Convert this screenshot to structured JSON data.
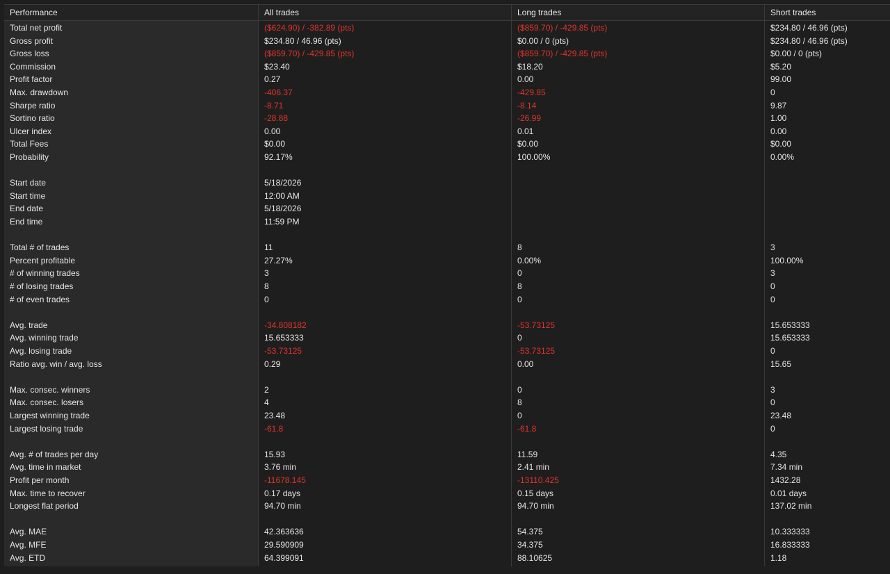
{
  "header": {
    "performance": "Performance",
    "all": "All trades",
    "long": "Long trades",
    "short": "Short trades"
  },
  "colors": {
    "negative": "#e0342a",
    "text": "#e6e6e6",
    "background": "#1e1e1e",
    "label_background": "#2a2a2a"
  },
  "rows": [
    {
      "label": "Total net profit",
      "all": "($624.90) / -382.89 (pts)",
      "long": "($859.70) / -429.85 (pts)",
      "short": "$234.80 / 46.96 (pts)",
      "neg": [
        1,
        1,
        0
      ]
    },
    {
      "label": "Gross profit",
      "all": "$234.80 / 46.96 (pts)",
      "long": "$0.00 / 0 (pts)",
      "short": "$234.80 / 46.96 (pts)",
      "neg": [
        0,
        0,
        0
      ]
    },
    {
      "label": "Gross loss",
      "all": "($859.70) / -429.85 (pts)",
      "long": "($859.70) / -429.85 (pts)",
      "short": "$0.00 / 0 (pts)",
      "neg": [
        1,
        1,
        0
      ]
    },
    {
      "label": "Commission",
      "all": "$23.40",
      "long": "$18.20",
      "short": "$5.20",
      "neg": [
        0,
        0,
        0
      ]
    },
    {
      "label": "Profit factor",
      "all": "0.27",
      "long": "0.00",
      "short": "99.00",
      "neg": [
        0,
        0,
        0
      ]
    },
    {
      "label": "Max. drawdown",
      "all": "-406.37",
      "long": "-429.85",
      "short": "0",
      "neg": [
        1,
        1,
        0
      ]
    },
    {
      "label": "Sharpe ratio",
      "all": "-8.71",
      "long": "-8.14",
      "short": "9.87",
      "neg": [
        1,
        1,
        0
      ]
    },
    {
      "label": "Sortino ratio",
      "all": "-28.88",
      "long": "-26.99",
      "short": "1.00",
      "neg": [
        1,
        1,
        0
      ]
    },
    {
      "label": "Ulcer index",
      "all": "0.00",
      "long": "0.01",
      "short": "0.00",
      "neg": [
        0,
        0,
        0
      ]
    },
    {
      "label": "Total Fees",
      "all": "$0.00",
      "long": "$0.00",
      "short": "$0.00",
      "neg": [
        0,
        0,
        0
      ]
    },
    {
      "label": "Probability",
      "all": "92.17%",
      "long": "100.00%",
      "short": "0.00%",
      "neg": [
        0,
        0,
        0
      ]
    },
    {
      "label": "",
      "all": "",
      "long": "",
      "short": "",
      "neg": [
        0,
        0,
        0
      ]
    },
    {
      "label": "Start date",
      "all": "5/18/2026",
      "long": "",
      "short": "",
      "neg": [
        0,
        0,
        0
      ]
    },
    {
      "label": "Start time",
      "all": "12:00 AM",
      "long": "",
      "short": "",
      "neg": [
        0,
        0,
        0
      ]
    },
    {
      "label": "End date",
      "all": "5/18/2026",
      "long": "",
      "short": "",
      "neg": [
        0,
        0,
        0
      ]
    },
    {
      "label": "End time",
      "all": "11:59 PM",
      "long": "",
      "short": "",
      "neg": [
        0,
        0,
        0
      ]
    },
    {
      "label": "",
      "all": "",
      "long": "",
      "short": "",
      "neg": [
        0,
        0,
        0
      ]
    },
    {
      "label": "Total # of trades",
      "all": "11",
      "long": "8",
      "short": "3",
      "neg": [
        0,
        0,
        0
      ]
    },
    {
      "label": "Percent profitable",
      "all": "27.27%",
      "long": "0.00%",
      "short": "100.00%",
      "neg": [
        0,
        0,
        0
      ]
    },
    {
      "label": "# of winning trades",
      "all": "3",
      "long": "0",
      "short": "3",
      "neg": [
        0,
        0,
        0
      ]
    },
    {
      "label": "# of losing trades",
      "all": "8",
      "long": "8",
      "short": "0",
      "neg": [
        0,
        0,
        0
      ]
    },
    {
      "label": "# of even trades",
      "all": "0",
      "long": "0",
      "short": "0",
      "neg": [
        0,
        0,
        0
      ]
    },
    {
      "label": "",
      "all": "",
      "long": "",
      "short": "",
      "neg": [
        0,
        0,
        0
      ]
    },
    {
      "label": "Avg. trade",
      "all": "-34.808182",
      "long": "-53.73125",
      "short": "15.653333",
      "neg": [
        1,
        1,
        0
      ]
    },
    {
      "label": "Avg. winning trade",
      "all": "15.653333",
      "long": "0",
      "short": "15.653333",
      "neg": [
        0,
        0,
        0
      ]
    },
    {
      "label": "Avg. losing trade",
      "all": "-53.73125",
      "long": "-53.73125",
      "short": "0",
      "neg": [
        1,
        1,
        0
      ]
    },
    {
      "label": "Ratio avg. win / avg. loss",
      "all": "0.29",
      "long": "0.00",
      "short": "15.65",
      "neg": [
        0,
        0,
        0
      ]
    },
    {
      "label": "",
      "all": "",
      "long": "",
      "short": "",
      "neg": [
        0,
        0,
        0
      ]
    },
    {
      "label": "Max. consec. winners",
      "all": "2",
      "long": "0",
      "short": "3",
      "neg": [
        0,
        0,
        0
      ]
    },
    {
      "label": "Max. consec. losers",
      "all": "4",
      "long": "8",
      "short": "0",
      "neg": [
        0,
        0,
        0
      ]
    },
    {
      "label": "Largest winning trade",
      "all": "23.48",
      "long": "0",
      "short": "23.48",
      "neg": [
        0,
        0,
        0
      ]
    },
    {
      "label": "Largest losing trade",
      "all": "-61.8",
      "long": "-61.8",
      "short": "0",
      "neg": [
        1,
        1,
        0
      ]
    },
    {
      "label": "",
      "all": "",
      "long": "",
      "short": "",
      "neg": [
        0,
        0,
        0
      ]
    },
    {
      "label": "Avg. # of trades per day",
      "all": "15.93",
      "long": "11.59",
      "short": "4.35",
      "neg": [
        0,
        0,
        0
      ]
    },
    {
      "label": "Avg. time in market",
      "all": "3.76 min",
      "long": "2.41 min",
      "short": "7.34 min",
      "neg": [
        0,
        0,
        0
      ]
    },
    {
      "label": "Profit per month",
      "all": "-11678.145",
      "long": "-13110.425",
      "short": "1432.28",
      "neg": [
        1,
        1,
        0
      ]
    },
    {
      "label": "Max. time to recover",
      "all": "0.17 days",
      "long": "0.15 days",
      "short": "0.01 days",
      "neg": [
        0,
        0,
        0
      ]
    },
    {
      "label": "Longest flat period",
      "all": "94.70 min",
      "long": "94.70 min",
      "short": "137.02 min",
      "neg": [
        0,
        0,
        0
      ]
    },
    {
      "label": "",
      "all": "",
      "long": "",
      "short": "",
      "neg": [
        0,
        0,
        0
      ]
    },
    {
      "label": "Avg. MAE",
      "all": "42.363636",
      "long": "54.375",
      "short": "10.333333",
      "neg": [
        0,
        0,
        0
      ]
    },
    {
      "label": "Avg. MFE",
      "all": "29.590909",
      "long": "34.375",
      "short": "16.833333",
      "neg": [
        0,
        0,
        0
      ]
    },
    {
      "label": "Avg. ETD",
      "all": "64.399091",
      "long": "88.10625",
      "short": "1.18",
      "neg": [
        0,
        0,
        0
      ]
    }
  ]
}
